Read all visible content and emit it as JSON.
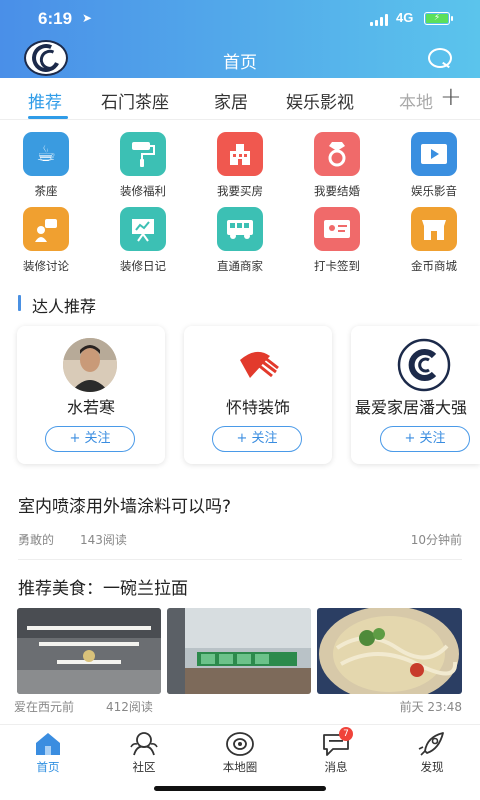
{
  "status": {
    "time": "6:19",
    "network": "4G"
  },
  "header": {
    "title": "首页"
  },
  "tabs": [
    {
      "label": "推荐",
      "active": true
    },
    {
      "label": "石门茶座",
      "active": false
    },
    {
      "label": "家居",
      "active": false
    },
    {
      "label": "娱乐影视",
      "active": false
    },
    {
      "label": "本地",
      "active": false
    }
  ],
  "categories": [
    {
      "label": "茶座",
      "color": "#3a9be0",
      "icon": "coffee-cup-icon"
    },
    {
      "label": "装修福利",
      "color": "#3cc0b4",
      "icon": "paint-roller-icon"
    },
    {
      "label": "我要买房",
      "color": "#f0584f",
      "icon": "building-icon"
    },
    {
      "label": "我要结婚",
      "color": "#f06a6a",
      "icon": "ring-icon"
    },
    {
      "label": "娱乐影音",
      "color": "#3a8fe0",
      "icon": "video-icon"
    },
    {
      "label": "装修讨论",
      "color": "#f0a030",
      "icon": "speaker-person-icon"
    },
    {
      "label": "装修日记",
      "color": "#3cc0b4",
      "icon": "whiteboard-icon"
    },
    {
      "label": "直通商家",
      "color": "#3cc0b4",
      "icon": "bus-icon"
    },
    {
      "label": "打卡签到",
      "color": "#f06a6a",
      "icon": "id-card-icon"
    },
    {
      "label": "金币商城",
      "color": "#f0a030",
      "icon": "shop-icon"
    }
  ],
  "section": {
    "title": "达人推荐"
  },
  "experts": [
    {
      "name": "水若寒",
      "follow": "+ 关注"
    },
    {
      "name": "怀特装饰",
      "follow": "+ 关注"
    },
    {
      "name": "最爱家居潘大强",
      "follow": "+ 关注"
    }
  ],
  "articles": [
    {
      "title": "室内喷漆用外墙涂料可以吗?",
      "author": "勇敢的",
      "reads": "143阅读",
      "time": "10分钟前"
    },
    {
      "title": "推荐美食：一碗兰拉面",
      "author": "爱在西元前",
      "reads": "412阅读",
      "time": "前天 23:48"
    }
  ],
  "bottom_nav": [
    {
      "label": "首页",
      "icon": "home-icon",
      "active": true
    },
    {
      "label": "社区",
      "icon": "community-icon",
      "active": false
    },
    {
      "label": "本地圈",
      "icon": "local-circle-icon",
      "active": false
    },
    {
      "label": "消息",
      "icon": "message-icon",
      "active": false,
      "badge": "7"
    },
    {
      "label": "发现",
      "icon": "rocket-icon",
      "active": false
    }
  ]
}
